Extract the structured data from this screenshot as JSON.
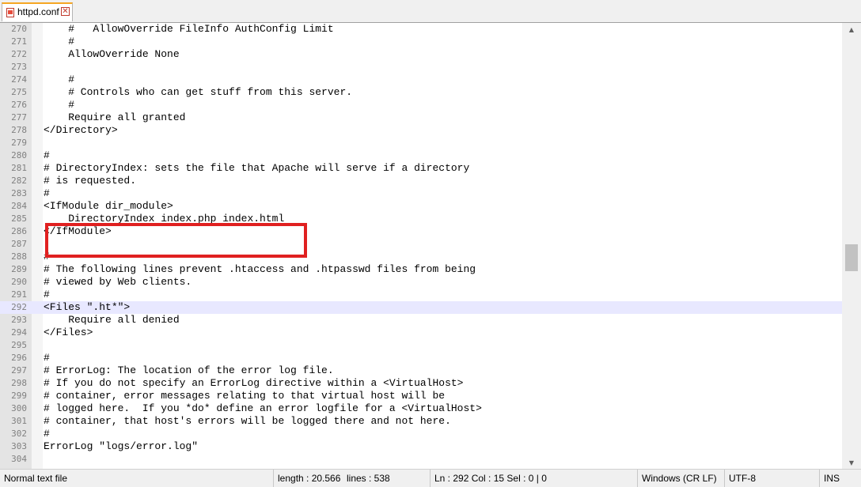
{
  "tab": {
    "label": "httpd.conf",
    "close_glyph": "✕"
  },
  "lines": [
    {
      "num": "270",
      "text": "    #   AllowOverride FileInfo AuthConfig Limit"
    },
    {
      "num": "271",
      "text": "    #"
    },
    {
      "num": "272",
      "text": "    AllowOverride None"
    },
    {
      "num": "273",
      "text": ""
    },
    {
      "num": "274",
      "text": "    #"
    },
    {
      "num": "275",
      "text": "    # Controls who can get stuff from this server."
    },
    {
      "num": "276",
      "text": "    #"
    },
    {
      "num": "277",
      "text": "    Require all granted"
    },
    {
      "num": "278",
      "text": "</Directory>"
    },
    {
      "num": "279",
      "text": ""
    },
    {
      "num": "280",
      "text": "#"
    },
    {
      "num": "281",
      "text": "# DirectoryIndex: sets the file that Apache will serve if a directory"
    },
    {
      "num": "282",
      "text": "# is requested."
    },
    {
      "num": "283",
      "text": "#"
    },
    {
      "num": "284",
      "text": "<IfModule dir_module>"
    },
    {
      "num": "285",
      "text": "    DirectoryIndex index.php index.html"
    },
    {
      "num": "286",
      "text": "</IfModule>"
    },
    {
      "num": "287",
      "text": ""
    },
    {
      "num": "288",
      "text": "#"
    },
    {
      "num": "289",
      "text": "# The following lines prevent .htaccess and .htpasswd files from being"
    },
    {
      "num": "290",
      "text": "# viewed by Web clients."
    },
    {
      "num": "291",
      "text": "#"
    },
    {
      "num": "292",
      "text": "<Files \".ht*\">"
    },
    {
      "num": "293",
      "text": "    Require all denied"
    },
    {
      "num": "294",
      "text": "</Files>"
    },
    {
      "num": "295",
      "text": ""
    },
    {
      "num": "296",
      "text": "#"
    },
    {
      "num": "297",
      "text": "# ErrorLog: The location of the error log file."
    },
    {
      "num": "298",
      "text": "# If you do not specify an ErrorLog directive within a <VirtualHost>"
    },
    {
      "num": "299",
      "text": "# container, error messages relating to that virtual host will be"
    },
    {
      "num": "300",
      "text": "# logged here.  If you *do* define an error logfile for a <VirtualHost>"
    },
    {
      "num": "301",
      "text": "# container, that host's errors will be logged there and not here."
    },
    {
      "num": "302",
      "text": "#"
    },
    {
      "num": "303",
      "text": "ErrorLog \"logs/error.log\""
    },
    {
      "num": "304",
      "text": ""
    }
  ],
  "current_line": "292",
  "status": {
    "file_type": "Normal text file",
    "length": "length : 20.566",
    "lines": "lines : 538",
    "position": "Ln : 292    Col : 15    Sel : 0 | 0",
    "eol": "Windows (CR LF)",
    "encoding": "UTF-8",
    "mode": "INS"
  },
  "colors": {
    "highlight_box": "#e02020",
    "current_line_bg": "#e8e8ff",
    "gutter_bg": "#e4e4e4"
  },
  "icons": {
    "tab_file": "file-modified-icon",
    "tab_close": "close-icon",
    "scroll_up": "up-arrow-icon",
    "scroll_down": "down-arrow-icon"
  }
}
